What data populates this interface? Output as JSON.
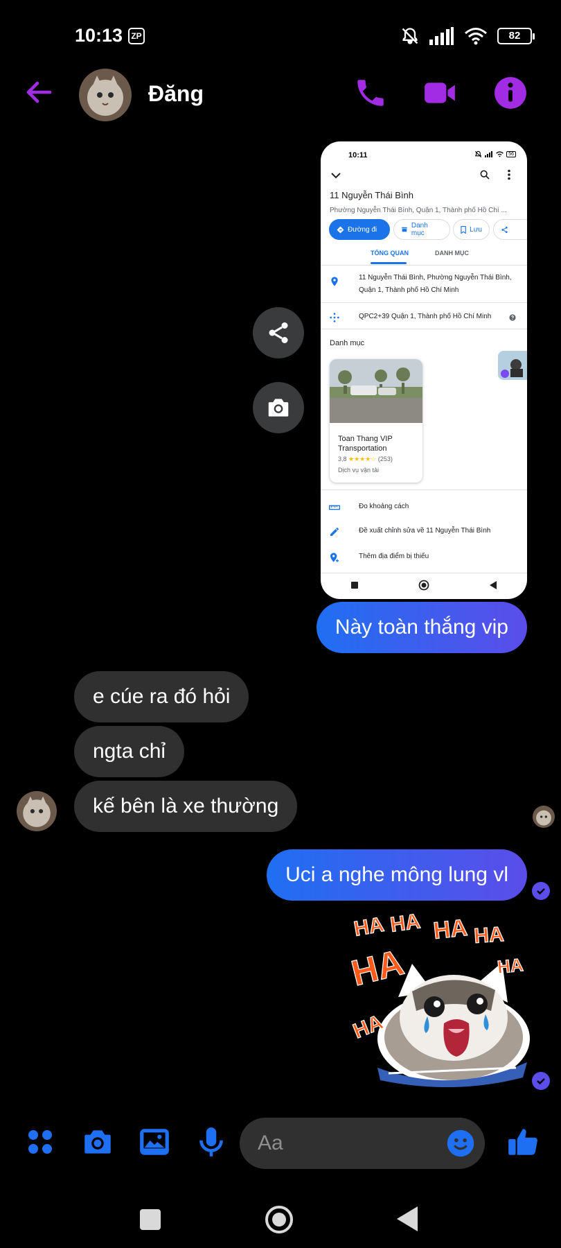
{
  "status_bar": {
    "time": "10:13",
    "zp_badge": "ZP",
    "battery": "82"
  },
  "header": {
    "contact_name": "Đăng"
  },
  "screenshot": {
    "status_time": "10:11",
    "battery": "56",
    "place_title": "11 Nguyễn Thái Bình",
    "place_subtitle": "Phường Nguyễn Thái Bình, Quận 1, Thành phố Hồ Chí ...",
    "actions": [
      "Đường đi",
      "Danh mục",
      "Lưu"
    ],
    "tabs": [
      "TỔNG QUAN",
      "DANH MỤC"
    ],
    "address": "11 Nguyễn Thái Bình, Phường Nguyễn Thái Bình, Quận 1, Thành phố Hồ Chí Minh",
    "plus_code": "QPC2+39 Quận 1, Thành phố Hồ Chí Minh",
    "section_title": "Danh mục",
    "business": {
      "name": "Toan Thang VIP Transportation",
      "rating": "3,8",
      "stars": "★★★★☆",
      "reviews": "(253)",
      "category": "Dịch vụ vận tải"
    },
    "list_items": [
      "Đo khoảng cách",
      "Đề xuất chỉnh sửa về 11 Nguyễn Thái Bình",
      "Thêm địa điểm bị thiếu"
    ]
  },
  "messages": {
    "m1": "Này toàn thắng vip",
    "m2": "e cúe ra đó hỏi",
    "m3": "ngta chỉ",
    "m4": "kế bên là xe thường",
    "m5": "Uci a nghe mông lung vl"
  },
  "sticker": {
    "text": [
      "HA",
      "HA",
      "HA",
      "HA",
      "HA",
      "HA",
      "HA"
    ]
  },
  "composer": {
    "placeholder": "Aa"
  },
  "colors": {
    "accent_purple": "#a22ce3",
    "messenger_blue": "#1f6ff2",
    "bubble_gradient_end": "#5b4dea",
    "incoming_bubble": "#303030"
  }
}
